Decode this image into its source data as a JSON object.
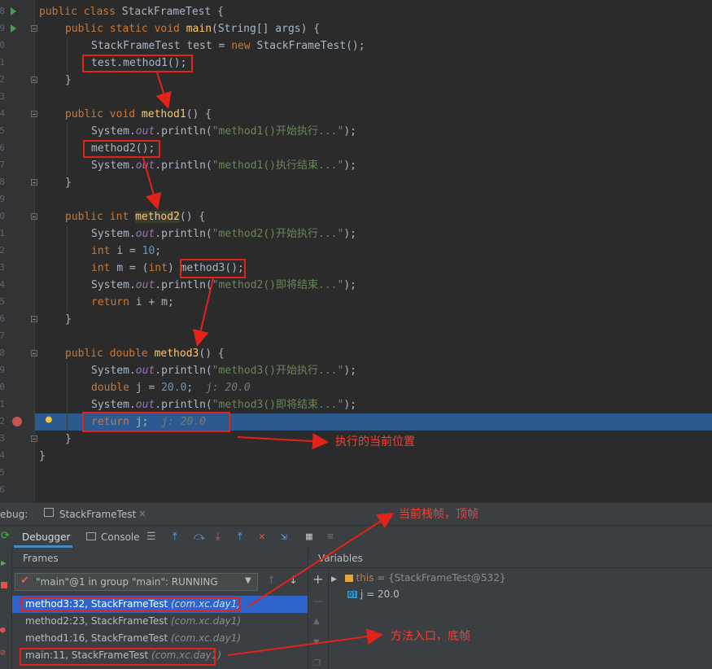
{
  "editor": {
    "line_numbers": [
      "8",
      "9",
      "0",
      "1",
      "2",
      "3",
      "4",
      "5",
      "6",
      "7",
      "8",
      "9",
      "0",
      "1",
      "2",
      "3",
      "4",
      "5",
      "6",
      "7",
      "8",
      "9",
      "0",
      "1",
      "2",
      "3",
      "4",
      "5",
      "6"
    ],
    "lines": {
      "l0": {
        "a": "public class ",
        "b": "StackFrameTest {"
      },
      "l1": {
        "a": "public static void ",
        "fn": "main",
        "b": "(String[] args) {"
      },
      "l2": {
        "a": "StackFrameTest test = ",
        "k": "new ",
        "b": "StackFrameTest();"
      },
      "l3": {
        "a": "test.method1();"
      },
      "l4": {
        "a": "}"
      },
      "l6": {
        "a": "public void ",
        "fn": "method1",
        "b": "() {"
      },
      "l7": {
        "a": "System.",
        "st": "out",
        "b": ".println(",
        "s": "\"method1()开始执行...\"",
        "c": ");"
      },
      "l8": {
        "a": "method2();"
      },
      "l9": {
        "a": "System.",
        "st": "out",
        "b": ".println(",
        "s": "\"method1()执行结束...\"",
        "c": ");"
      },
      "l10": {
        "a": "}"
      },
      "l12": {
        "a": "public int ",
        "fn": "method2",
        "b": "() {"
      },
      "l13": {
        "a": "System.",
        "st": "out",
        "b": ".println(",
        "s": "\"method2()开始执行...\"",
        "c": ");"
      },
      "l14": {
        "k": "int ",
        "a": "i = ",
        "n": "10",
        "b": ";"
      },
      "l15": {
        "k": "int ",
        "a": "m = (",
        "k2": "int",
        "b": ") method3();"
      },
      "l16": {
        "a": "System.",
        "st": "out",
        "b": ".println(",
        "s": "\"method2()即将结束...\"",
        "c": ");"
      },
      "l17": {
        "k": "return ",
        "a": "i + m;"
      },
      "l18": {
        "a": "}"
      },
      "l20": {
        "a": "public double ",
        "fn": "method3",
        "b": "() {"
      },
      "l21": {
        "a": "System.",
        "st": "out",
        "b": ".println(",
        "s": "\"method3()开始执行...\"",
        "c": ");"
      },
      "l22": {
        "k": "double ",
        "a": "j = ",
        "n": "20.0",
        "b": ";",
        "ih": "j: 20.0"
      },
      "l23": {
        "a": "System.",
        "st": "out",
        "b": ".println(",
        "s": "\"method3()即将结束...\"",
        "c": ");"
      },
      "l24": {
        "k": "return ",
        "a": "j;",
        "ih": "j: 20.0"
      },
      "l25": {
        "a": "}"
      },
      "l26": {
        "a": "}"
      }
    },
    "current_line_gutter_number": "2"
  },
  "debug": {
    "title_prefix": "ebug:",
    "tab_label": "StackFrameTest",
    "tab_close": "×",
    "tabs": {
      "debugger": "Debugger",
      "console": "Console"
    },
    "frames": {
      "title": "Frames",
      "thread_dropdown": "\"main\"@1 in group \"main\": RUNNING",
      "rows": [
        {
          "main": "method3:32, StackFrameTest ",
          "pkg": "(com.xc.day1)"
        },
        {
          "main": "method2:23, StackFrameTest ",
          "pkg": "(com.xc.day1)"
        },
        {
          "main": "method1:16, StackFrameTest ",
          "pkg": "(com.xc.day1)"
        },
        {
          "main": "main:11, StackFrameTest ",
          "pkg": "(com.xc.day1)"
        }
      ]
    },
    "variables": {
      "title": "Variables",
      "rows": [
        {
          "name": "this",
          "value": " = {StackFrameTest@532}"
        },
        {
          "badge": "01",
          "name": "j",
          "value": " = 20.0"
        }
      ]
    }
  },
  "annotations": {
    "current_position": "执行的当前位置",
    "top_frame": "当前栈帧，顶帧",
    "bottom_frame": "方法入口，底帧"
  },
  "colors": {
    "annotation_red": "#e2231a",
    "selection_blue": "#2f65ca",
    "exec_line": "#2d5a8e"
  }
}
